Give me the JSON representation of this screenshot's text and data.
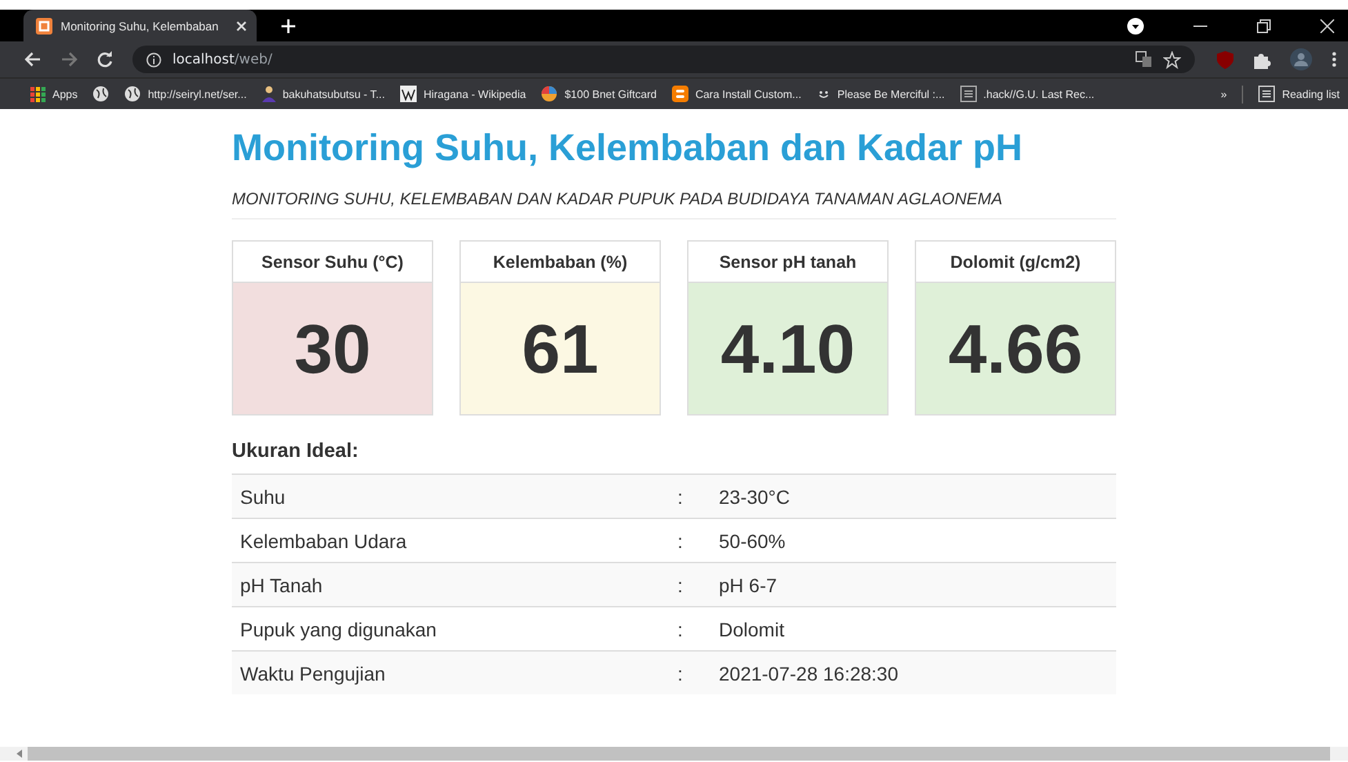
{
  "browser": {
    "tab_title": "Monitoring Suhu, Kelembaban",
    "url_host": "localhost",
    "url_path": "/web/",
    "bookmarks": [
      {
        "label": "Apps",
        "kind": "apps"
      },
      {
        "kind": "globe"
      },
      {
        "label": "http://seiryl.net/ser...",
        "kind": "globe"
      },
      {
        "label": "bakuhatsubutsu - T...",
        "kind": "person"
      },
      {
        "label": "Hiragana - Wikipedia",
        "kind": "wiki"
      },
      {
        "label": "$100 Bnet Giftcard",
        "kind": "pie"
      },
      {
        "label": "Cara Install Custom...",
        "kind": "blogger"
      },
      {
        "label": "Please Be Merciful :...",
        "kind": "smile"
      },
      {
        "label": ".hack//G.U. Last Rec...",
        "kind": "doc"
      }
    ],
    "overflow": "»",
    "reading_list": "Reading list"
  },
  "page": {
    "title": "Monitoring Suhu, Kelembaban dan Kadar pH",
    "subtitle": "MONITORING SUHU, KELEMBABAN DAN KADAR PUPUK PADA BUDIDAYA TANAMAN AGLAONEMA",
    "cards": [
      {
        "label": "Sensor Suhu (°C)",
        "value": "30",
        "color": "#f2dede"
      },
      {
        "label": "Kelembaban (%)",
        "value": "61",
        "color": "#fcf8e3"
      },
      {
        "label": "Sensor pH tanah",
        "value": "4.10",
        "color": "#dff0d8"
      },
      {
        "label": "Dolomit (g/cm2)",
        "value": "4.66",
        "color": "#dff0d8"
      }
    ],
    "ideal_heading": "Ukuran Ideal:",
    "ideal_rows": [
      {
        "name": "Suhu",
        "sep": ":",
        "value": "23-30°C"
      },
      {
        "name": "Kelembaban Udara",
        "sep": ":",
        "value": "50-60%"
      },
      {
        "name": "pH Tanah",
        "sep": ":",
        "value": "pH 6-7"
      },
      {
        "name": "Pupuk yang digunakan",
        "sep": ":",
        "value": "Dolomit"
      },
      {
        "name": "Waktu Pengujian",
        "sep": ":",
        "value": "2021-07-28 16:28:30"
      }
    ]
  }
}
